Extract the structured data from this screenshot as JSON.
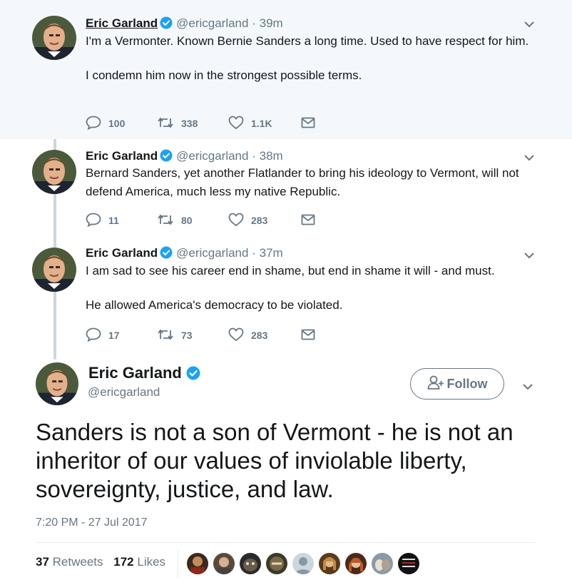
{
  "thread": [
    {
      "name": "Eric Garland",
      "handle": "@ericgarland",
      "time": "39m",
      "paragraphs": [
        "I'm a Vermonter. Known Bernie Sanders a long time. Used to have respect for him.",
        "I condemn him now in the strongest possible terms."
      ],
      "replies": "100",
      "retweets": "338",
      "likes": "1.1K"
    },
    {
      "name": "Eric Garland",
      "handle": "@ericgarland",
      "time": "38m",
      "paragraphs": [
        "Bernard Sanders, yet another Flatlander to bring his ideology to Vermont, will not defend America, much less my native Republic."
      ],
      "replies": "11",
      "retweets": "80",
      "likes": "283"
    },
    {
      "name": "Eric Garland",
      "handle": "@ericgarland",
      "time": "37m",
      "paragraphs": [
        "I am sad to see his career end in shame, but end in shame it will - and must.",
        "He allowed America's democracy to be violated."
      ],
      "replies": "17",
      "retweets": "73",
      "likes": "283"
    }
  ],
  "main": {
    "name": "Eric Garland",
    "handle": "@ericgarland",
    "follow_label": "Follow",
    "text": "Sanders is not a son of Vermont - he is not an inheritor of our values of inviolable liberty, sovereignty, justice, and law.",
    "date": "7:20 PM - 27 Jul 2017",
    "retweet_count": "37",
    "retweet_label": "Retweets",
    "like_count": "172",
    "like_label": "Likes"
  },
  "separator_dot": "·",
  "icons": {
    "verified": "verified-badge-icon",
    "chevron": "chevron-down-icon",
    "reply": "reply-icon",
    "retweet": "retweet-icon",
    "like": "heart-icon",
    "dm": "envelope-icon",
    "follow": "follow-person-icon"
  },
  "colors": {
    "verified": "#1da1f2",
    "text": "#14171a",
    "muted": "#657786",
    "highlight_bg": "#f5f8fa",
    "thread_line": "#ccd6dd"
  },
  "liker_avatar_count": 9
}
